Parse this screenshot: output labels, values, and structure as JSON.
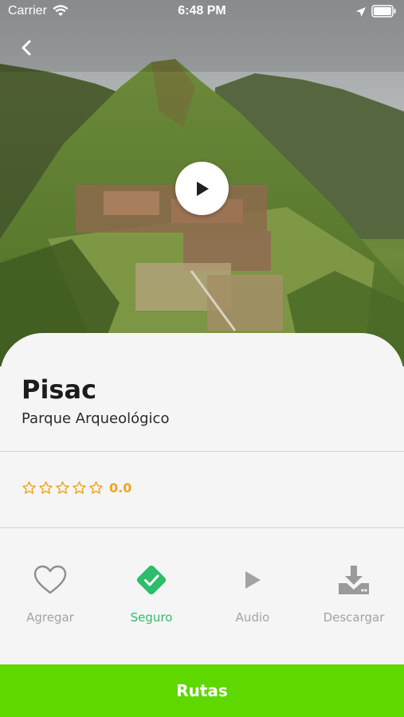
{
  "status_bar": {
    "carrier": "Carrier",
    "time": "6:48 PM"
  },
  "header": {
    "back_icon": "chevron-left-icon"
  },
  "media": {
    "play_icon": "play-icon"
  },
  "place": {
    "name": "Pisac",
    "category": "Parque Arqueológico"
  },
  "rating": {
    "value": "0.0",
    "stars": 0,
    "max_stars": 5,
    "color": "#f2a41c"
  },
  "actions": [
    {
      "label": "Agregar",
      "icon": "heart-icon",
      "active": false
    },
    {
      "label": "Seguro",
      "icon": "check-diamond-icon",
      "active": true
    },
    {
      "label": "Audio",
      "icon": "play-icon",
      "active": false
    },
    {
      "label": "Descargar",
      "icon": "download-icon",
      "active": false
    }
  ],
  "footer": {
    "button_label": "Rutas",
    "color": "#5fd800"
  },
  "colors": {
    "accent_green": "#2ebd6b",
    "muted": "#a3a3a3"
  }
}
